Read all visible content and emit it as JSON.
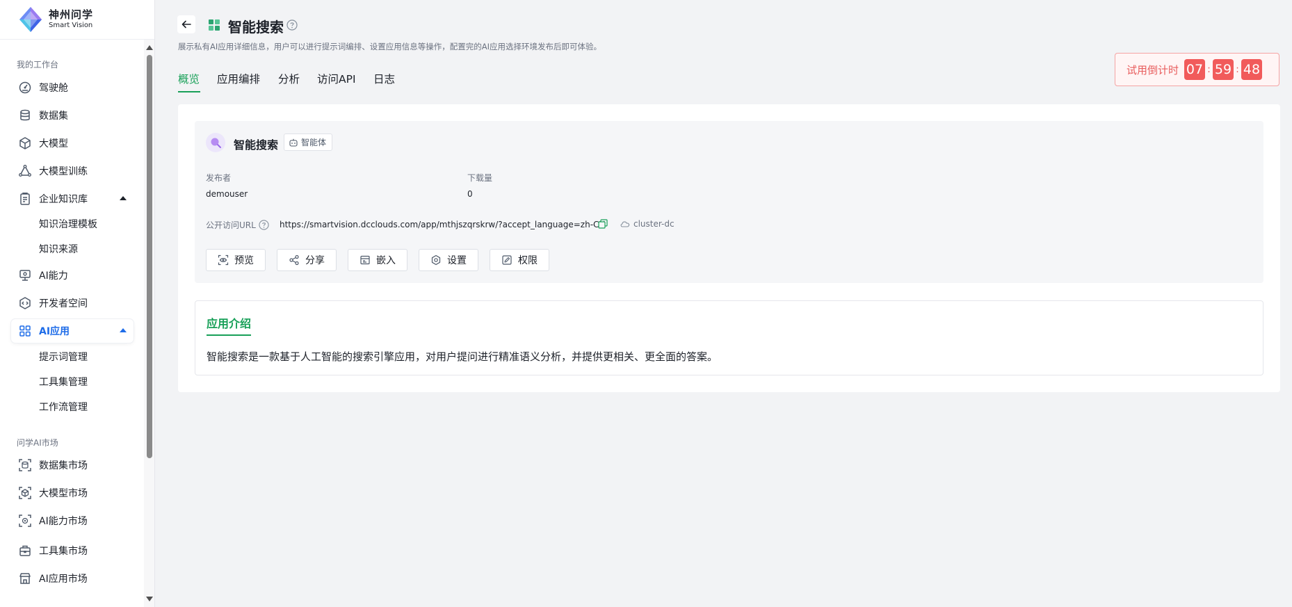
{
  "brand": {
    "name_cn": "神州问学",
    "name_en": "Smart Vision"
  },
  "sidebar": {
    "section_workspace": "我的工作台",
    "items": [
      {
        "label": "驾驶舱",
        "icon": "dashboard-icon"
      },
      {
        "label": "数据集",
        "icon": "database-icon"
      },
      {
        "label": "大模型",
        "icon": "cube-icon"
      },
      {
        "label": "大模型训练",
        "icon": "training-icon"
      },
      {
        "label": "企业知识库",
        "icon": "knowledge-icon"
      },
      {
        "label": "AI能力",
        "icon": "ai-monitor-icon"
      },
      {
        "label": "开发者空间",
        "icon": "developer-icon"
      },
      {
        "label": "AI应用",
        "icon": "grid-apps-icon"
      }
    ],
    "knowledge_sub": [
      "知识治理模板",
      "知识来源"
    ],
    "ai_app_sub": [
      "提示词管理",
      "工具集管理",
      "工作流管理"
    ],
    "section_market": "问学AI市场",
    "market_items": [
      {
        "label": "数据集市场",
        "icon": "dataset-market-icon"
      },
      {
        "label": "大模型市场",
        "icon": "model-market-icon"
      },
      {
        "label": "AI能力市场",
        "icon": "ai-market-icon"
      },
      {
        "label": "工具集市场",
        "icon": "toolbox-market-icon"
      },
      {
        "label": "AI应用市场",
        "icon": "app-store-icon"
      }
    ]
  },
  "header": {
    "title": "智能搜索",
    "description": "展示私有AI应用详细信息，用户可以进行提示词编排、设置应用信息等操作，配置完的AI应用选择环境发布后即可体验。",
    "tabs": [
      "概览",
      "应用编排",
      "分析",
      "访问API",
      "日志"
    ],
    "active_tab": "概览"
  },
  "countdown": {
    "label": "试用倒计时",
    "hours": "07",
    "minutes": "59",
    "seconds": "48",
    "separator": ":"
  },
  "app": {
    "name": "智能搜索",
    "type_badge": "智能体",
    "publisher_label": "发布者",
    "publisher": "demouser",
    "downloads_label": "下载量",
    "downloads": "0",
    "url_label": "公开访问URL",
    "url": "https://smartvision.dcclouds.com/app/mthjszqrskrw/?accept_language=zh-CN",
    "cluster": "cluster-dc",
    "actions": [
      "预览",
      "分享",
      "嵌入",
      "设置",
      "权限"
    ]
  },
  "intro": {
    "title": "应用介绍",
    "text": "智能搜索是一款基于人工智能的搜索引擎应用，对用户提问进行精准语义分析，并提供更相关、更全面的答案。"
  },
  "colors": {
    "accent_green": "#18a058",
    "active_blue": "#1e6ce8",
    "countdown_red": "#f15b5b"
  }
}
